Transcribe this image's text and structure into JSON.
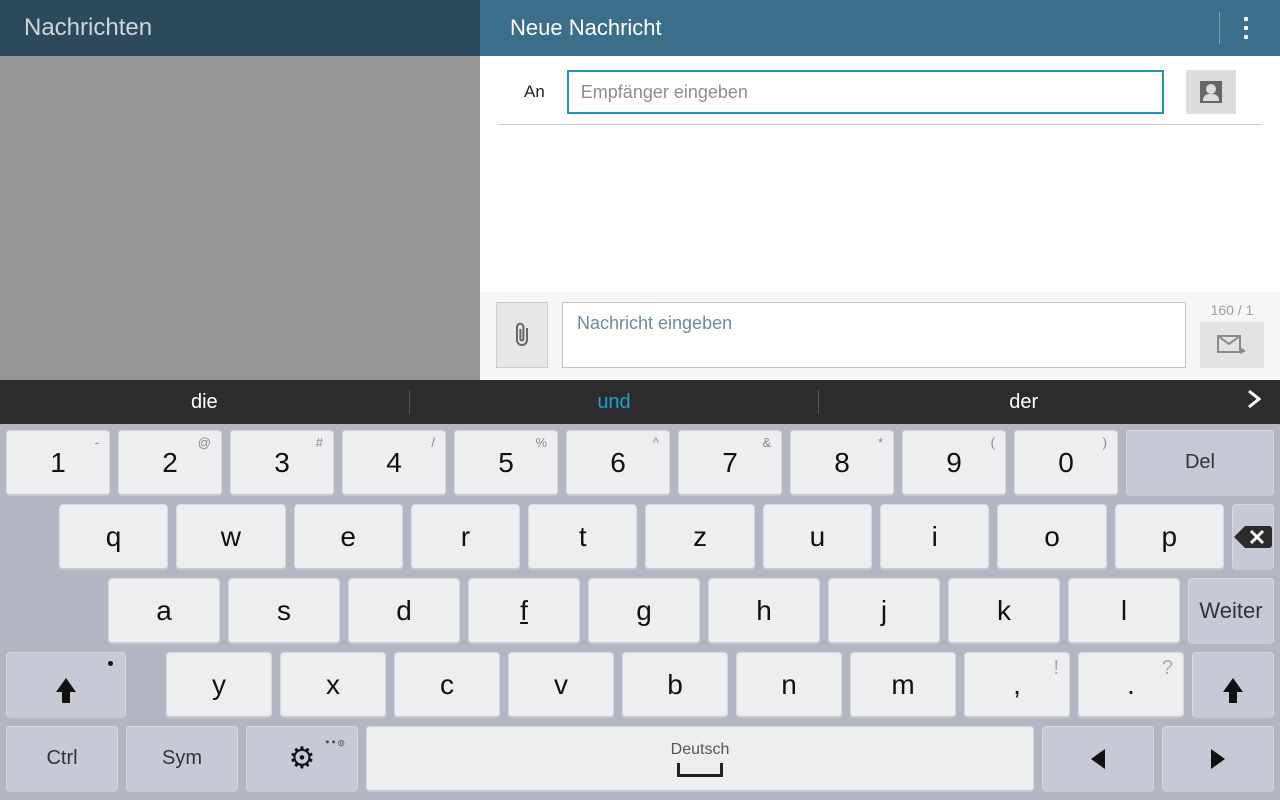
{
  "headers": {
    "left": "Nachrichten",
    "right": "Neue Nachricht"
  },
  "to": {
    "label": "An",
    "placeholder": "Empfänger eingeben"
  },
  "compose": {
    "placeholder": "Nachricht eingeben",
    "counter": "160 / 1"
  },
  "suggestions": {
    "a": "die",
    "b": "und",
    "c": "der"
  },
  "row0": {
    "k1": {
      "m": "1",
      "s": "-"
    },
    "k2": {
      "m": "2",
      "s": "@"
    },
    "k3": {
      "m": "3",
      "s": "#"
    },
    "k4": {
      "m": "4",
      "s": "/"
    },
    "k5": {
      "m": "5",
      "s": "%"
    },
    "k6": {
      "m": "6",
      "s": "^"
    },
    "k7": {
      "m": "7",
      "s": "&"
    },
    "k8": {
      "m": "8",
      "s": "*"
    },
    "k9": {
      "m": "9",
      "s": "("
    },
    "k0": {
      "m": "0",
      "s": ")"
    },
    "del": "Del"
  },
  "row1": {
    "q": "q",
    "w": "w",
    "e": "e",
    "r": "r",
    "t": "t",
    "z": "z",
    "u": "u",
    "i": "i",
    "o": "o",
    "p": "p"
  },
  "row2": {
    "a": "a",
    "s": "s",
    "d": "d",
    "f": "f",
    "g": "g",
    "h": "h",
    "j": "j",
    "k": "k",
    "l": "l",
    "weiter": "Weiter"
  },
  "row3": {
    "y": "y",
    "x": "x",
    "c": "c",
    "v": "v",
    "b": "b",
    "n": "n",
    "m": "m",
    "comma": ",",
    "comma_s": "!",
    "dot": ".",
    "dot_s": "?"
  },
  "row4": {
    "ctrl": "Ctrl",
    "sym": "Sym",
    "lang": "Deutsch"
  }
}
